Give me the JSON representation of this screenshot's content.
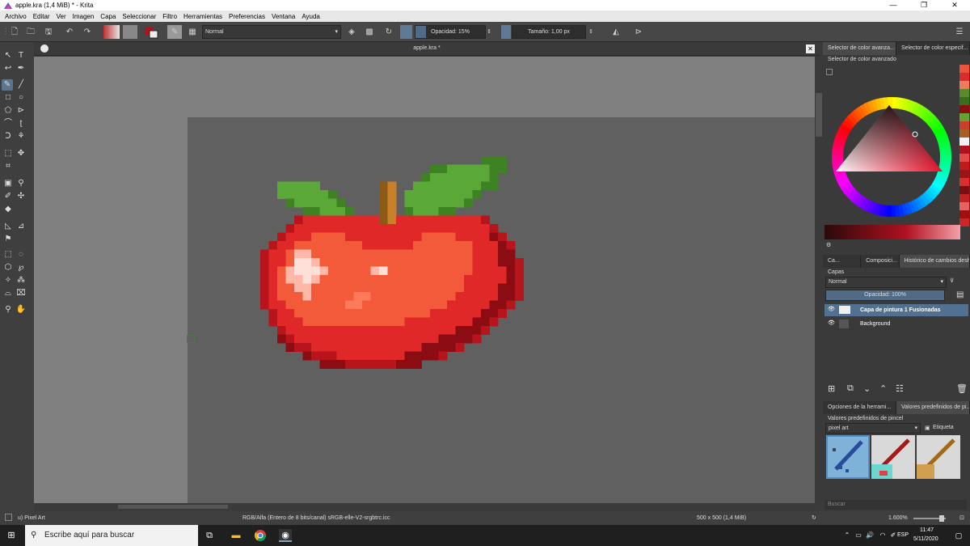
{
  "window": {
    "title": "apple.kra (1,4 MiB)  * - Krita",
    "controls": [
      "—",
      "❐",
      "✕"
    ]
  },
  "menu": [
    "Archivo",
    "Editar",
    "Ver",
    "Imagen",
    "Capa",
    "Seleccionar",
    "Filtro",
    "Herramientas",
    "Preferencias",
    "Ventana",
    "Ayuda"
  ],
  "toolbar": {
    "blend_mode": "Normal",
    "opacity_label": "Opacidad: 15%",
    "opacity_value": 0.15,
    "size_label": "Tamaño: 1,00 px"
  },
  "document": {
    "tab_title": "apple.kra *",
    "close": "✕"
  },
  "colors": {
    "accent": "#52708f",
    "selected": "#5a7590"
  },
  "color_panel": {
    "tabs": [
      "Selector de color avanza...",
      "Selector de color especif..."
    ],
    "header": "Selector de color avanzado"
  },
  "layers_panel": {
    "tabs": [
      "Ca...",
      "Composici...",
      "Histórico de cambios deshe..."
    ],
    "title": "Capas",
    "blend_mode": "Normal",
    "opacity_label": "Opacidad:  100%",
    "opacity_value": 1.0,
    "layers": [
      {
        "name": "Capa de pintura 1 Fusionadas",
        "selected": true
      },
      {
        "name": "Background",
        "selected": false
      }
    ]
  },
  "presets_panel": {
    "tabs": [
      "Opciones de la herrami...",
      "Valores predefinidos de pi..."
    ],
    "header": "Valores predefinidos de pincel",
    "tag_value": "pixel art",
    "tag_button": "Etiqueta",
    "search_placeholder": "Buscar"
  },
  "status": {
    "brush": "u) Pixel Art",
    "colorspace": "RGB/Alfa (Entero de 8 bits/canal)  sRGB-elle-V2-srgbtrc.icc",
    "size": "500 x 500 (1,4 MiB)",
    "zoom": "1.600%"
  },
  "taskbar": {
    "search_placeholder": "Escribe aquí para buscar",
    "lang": "ESP",
    "time": "11:47",
    "date": "5/11/2020"
  }
}
